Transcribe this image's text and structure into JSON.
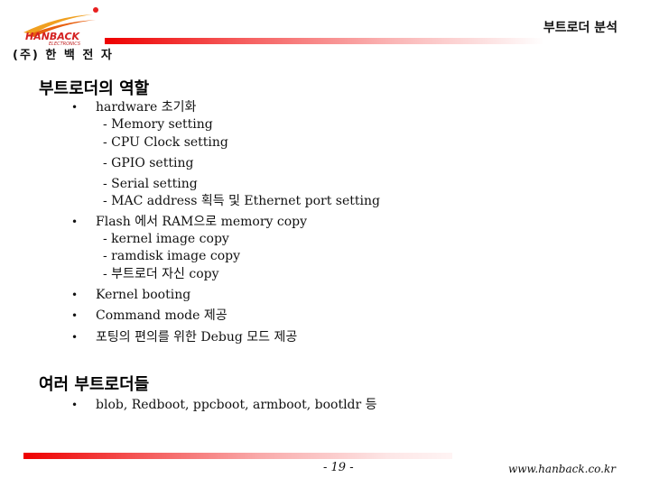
{
  "header": {
    "logo_brand": "HANBACK",
    "logo_sub": "ELECTRONICS",
    "logo_company": "(주) 한 백 전 자",
    "slide_title": "부트로더 분석",
    "accent_color": "#ee0000"
  },
  "section1": {
    "heading": "부트로더의 역할",
    "bullets": [
      {
        "label": "hardware 초기화",
        "subitems": [
          "- Memory setting",
          "- CPU Clock setting",
          "- GPIO setting",
          "- Serial setting",
          "- MAC address 획득 및 Ethernet port setting"
        ]
      },
      {
        "label": "Flash 에서 RAM으로 memory copy",
        "subitems": [
          "- kernel image copy",
          "- ramdisk image copy",
          "- 부트로더 자신 copy"
        ]
      },
      {
        "label": "Kernel booting",
        "subitems": []
      },
      {
        "label": "Command mode 제공",
        "subitems": []
      },
      {
        "label": "포팅의 편의를 위한 Debug 모드 제공",
        "subitems": []
      }
    ]
  },
  "section2": {
    "heading": "여러 부트로더들",
    "bullets": [
      {
        "label": "blob, Redboot, ppcboot, armboot, bootldr 등",
        "subitems": []
      }
    ]
  },
  "bullet_glyph": "•",
  "footer": {
    "page_number": "- 19 -",
    "website": "www.hanback.co.kr"
  }
}
